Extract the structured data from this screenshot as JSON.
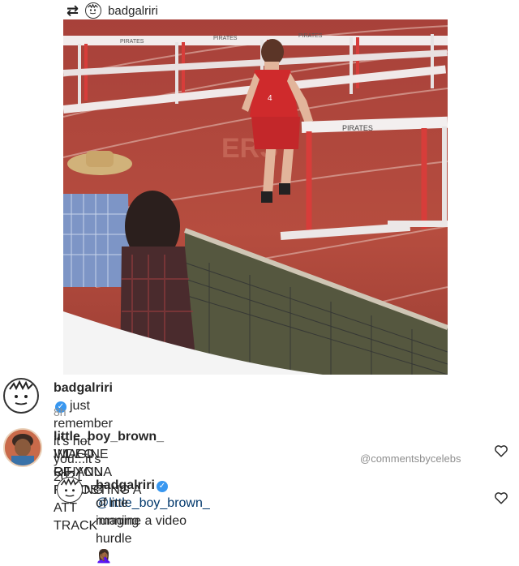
{
  "repost": {
    "icon": "repost-icon",
    "username": "badgalriri"
  },
  "media": {
    "hurdle_label_front": "PIRATES",
    "hurdle_label_back_1": "PIRATES",
    "hurdle_label_back_2": "PIRATES",
    "hurdle_label_back_3": "PIRATES",
    "jersey_text": "4",
    "track_letters": "ERS"
  },
  "caption": {
    "username": "badgalriri",
    "verified": true,
    "text": "just remember it’s not you...it’s 2021",
    "time": "8h"
  },
  "comments": [
    {
      "username": "little_boy_brown_",
      "text_line1": "IMAGINE RIHANNA REPOSTING A",
      "text_line2": "VIDEO OF YOU FAILING ATT TRACK",
      "watermark": "@commentsbycelebs",
      "icon": "heart-icon"
    },
    {
      "username": "badgalriri",
      "verified": true,
      "mention": "@little_boy_brown_",
      "text_line1": "imagine a video",
      "text_line2": "of me running hurdle",
      "emoji": "🤦🏾‍♀️",
      "icon": "heart-icon"
    }
  ],
  "colors": {
    "track": "#b1493c",
    "verified": "#3897f0",
    "mention": "#00376b",
    "muted": "#8e8e8e"
  }
}
